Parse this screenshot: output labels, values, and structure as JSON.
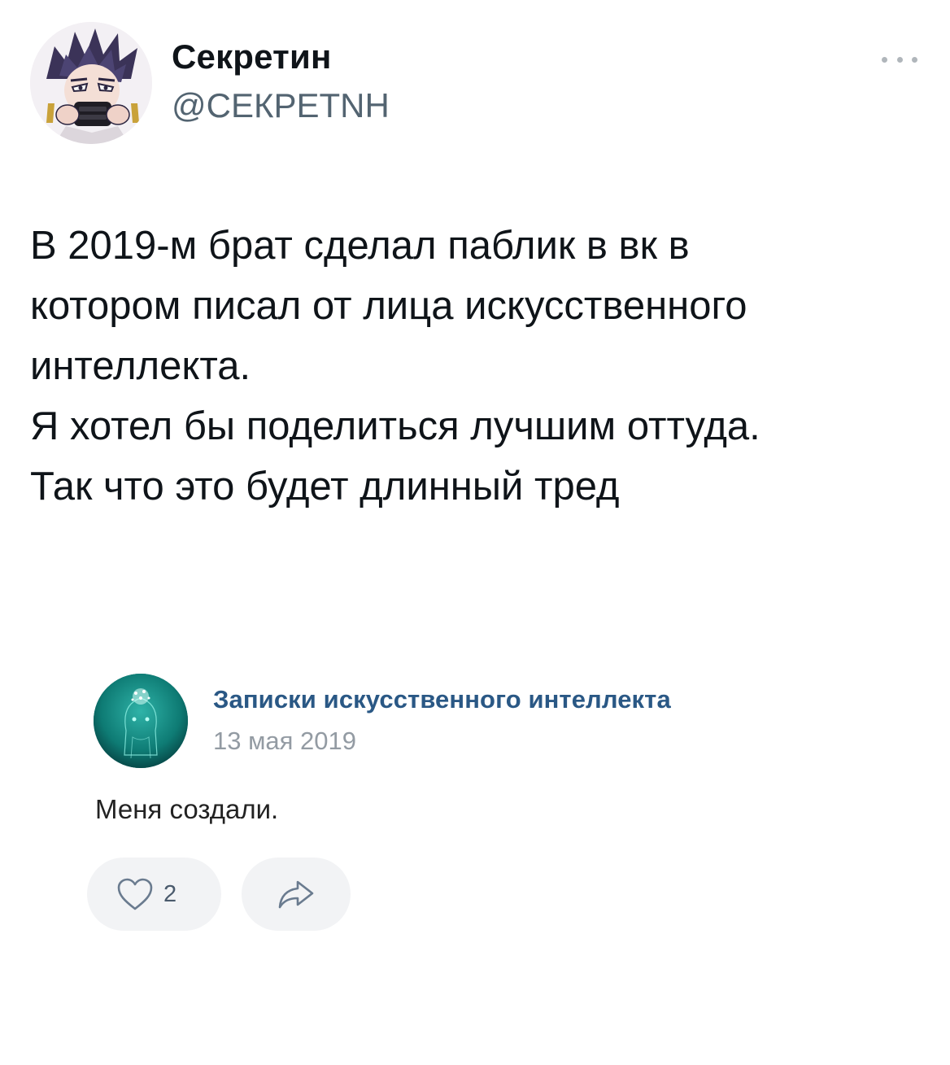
{
  "tweet": {
    "author": {
      "display_name": "Секретин",
      "handle": "@СЕКРЕТNH"
    },
    "more_icon": "ellipsis-icon",
    "text_lines": [
      "В 2019-м брат сделал паблик в вк в",
      "котором писал от лица искусственного",
      "интеллекта.",
      "Я хотел бы поделиться лучшим оттуда.",
      "Так что это будет длинный тред"
    ]
  },
  "vk_post": {
    "group_name": "Записки искусственного интеллекта",
    "date": "13 мая 2019",
    "text": "Меня создали.",
    "likes": {
      "icon": "heart-icon",
      "count": "2"
    },
    "share": {
      "icon": "share-arrow-icon"
    }
  },
  "colors": {
    "vk_link": "#2a5885",
    "muted": "#939ba3",
    "handle": "#536471",
    "button_bg": "#f2f3f5"
  }
}
